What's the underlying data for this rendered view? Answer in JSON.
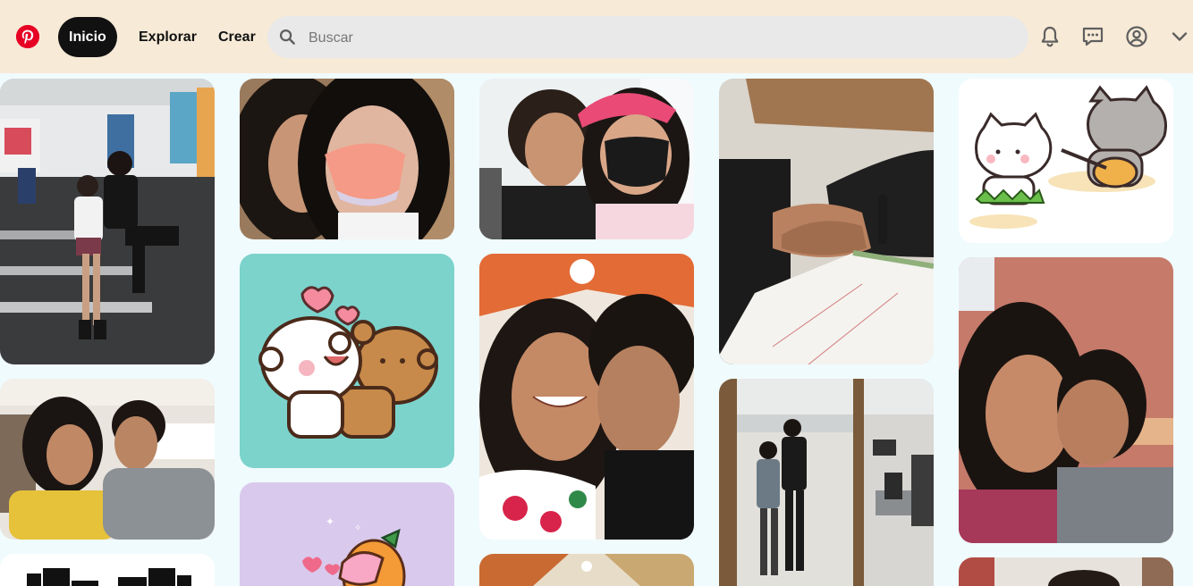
{
  "header": {
    "nav": [
      {
        "label": "Inicio",
        "active": true
      },
      {
        "label": "Explorar",
        "active": false
      },
      {
        "label": "Crear",
        "active": false
      }
    ],
    "search": {
      "placeholder": "Buscar",
      "value": ""
    },
    "icons": [
      "pinterest-logo-icon",
      "search-icon",
      "bell-icon",
      "messages-icon",
      "profile-icon",
      "chevron-down-icon"
    ]
  },
  "colors": {
    "header_bg": "#f7ead7",
    "page_bg": "#f0fbfd",
    "brand": "#e60023",
    "active_tab": "#111111"
  },
  "pins": [
    {
      "column": 1,
      "subject": "group-photo-skating-rink"
    },
    {
      "column": 1,
      "subject": "couple-selfie-indoors"
    },
    {
      "column": 1,
      "subject": "black-white-graphic"
    },
    {
      "column": 2,
      "subject": "couple-selfie-pink-mask"
    },
    {
      "column": 2,
      "subject": "bear-sticker-teal"
    },
    {
      "column": 2,
      "subject": "bunny-carrot-sticker-lilac"
    },
    {
      "column": 3,
      "subject": "couple-selfie-pink-cap"
    },
    {
      "column": 3,
      "subject": "couple-selfie-floral-shirt"
    },
    {
      "column": 3,
      "subject": "ceiling-photo"
    },
    {
      "column": 4,
      "subject": "holding-hands-notebook"
    },
    {
      "column": 4,
      "subject": "mirror-selfie-lobby"
    },
    {
      "column": 5,
      "subject": "cat-sticker-ukulele"
    },
    {
      "column": 5,
      "subject": "couple-selfie-pink-wall"
    },
    {
      "column": 5,
      "subject": "partial-photo"
    }
  ]
}
